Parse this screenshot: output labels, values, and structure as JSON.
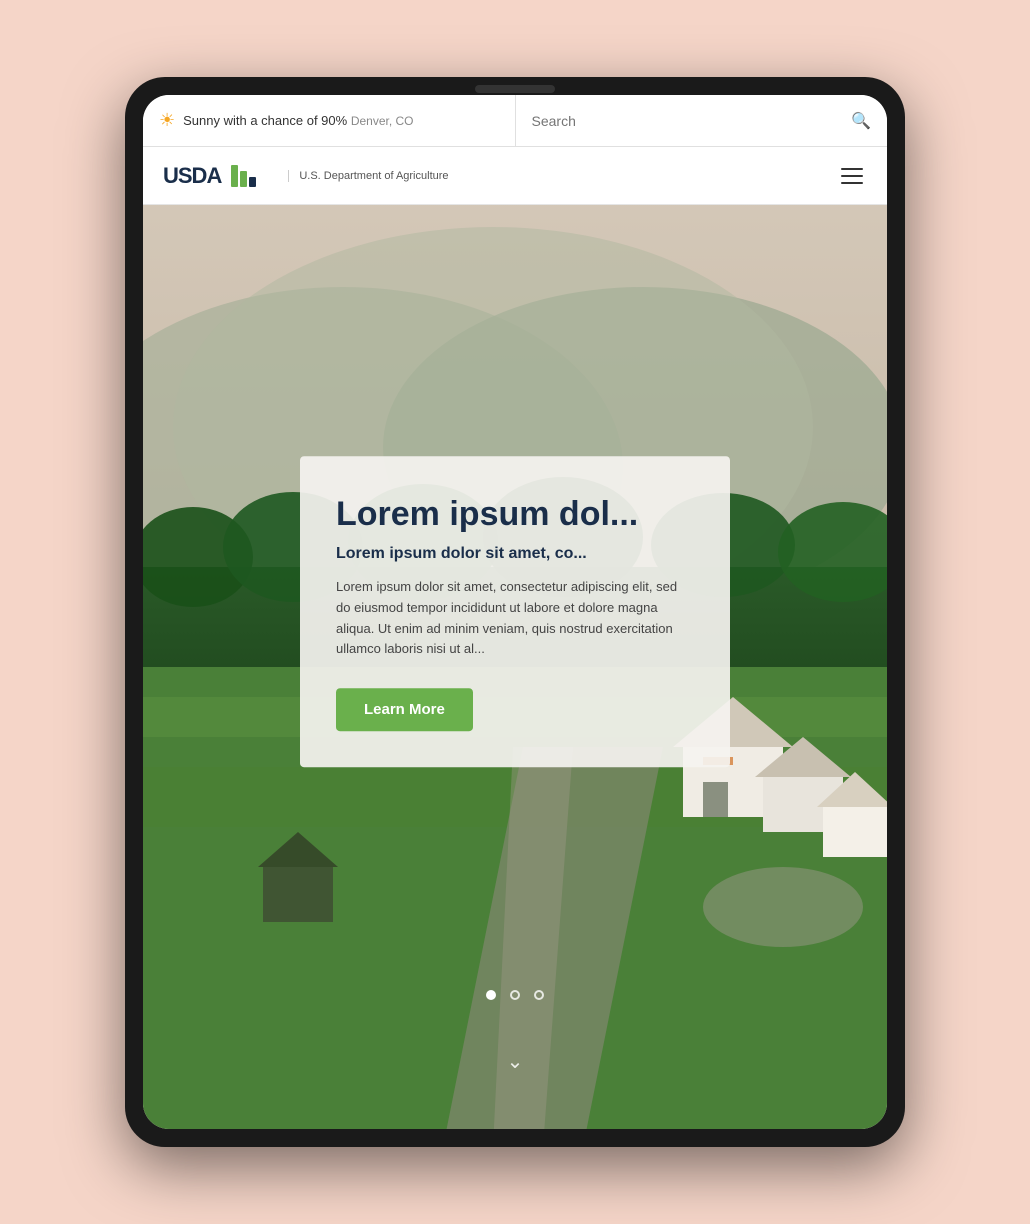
{
  "tablet": {
    "background_color": "#f5d5c8"
  },
  "top_bar": {
    "weather_icon": "☀",
    "weather_text": "Sunny with a chance of 90%",
    "weather_location": "Denver, CO",
    "search_placeholder": "Search",
    "search_icon": "🔍"
  },
  "nav": {
    "logo_text": "USDA",
    "logo_subtitle": "U.S. Department of Agriculture",
    "menu_icon": "≡"
  },
  "hero": {
    "title": "Lorem ipsum dol...",
    "subtitle": "Lorem ipsum dolor sit amet, co...",
    "body": "Lorem ipsum dolor sit amet, consectetur adipiscing elit, sed do eiusmod tempor incididunt ut labore et dolore magna aliqua. Ut enim ad minim veniam, quis nostrud exercitation ullamco laboris nisi ut al...",
    "cta_label": "Learn More"
  },
  "carousel": {
    "dots": [
      {
        "active": true
      },
      {
        "active": false
      },
      {
        "active": false
      }
    ],
    "scroll_down_icon": "⌄"
  }
}
